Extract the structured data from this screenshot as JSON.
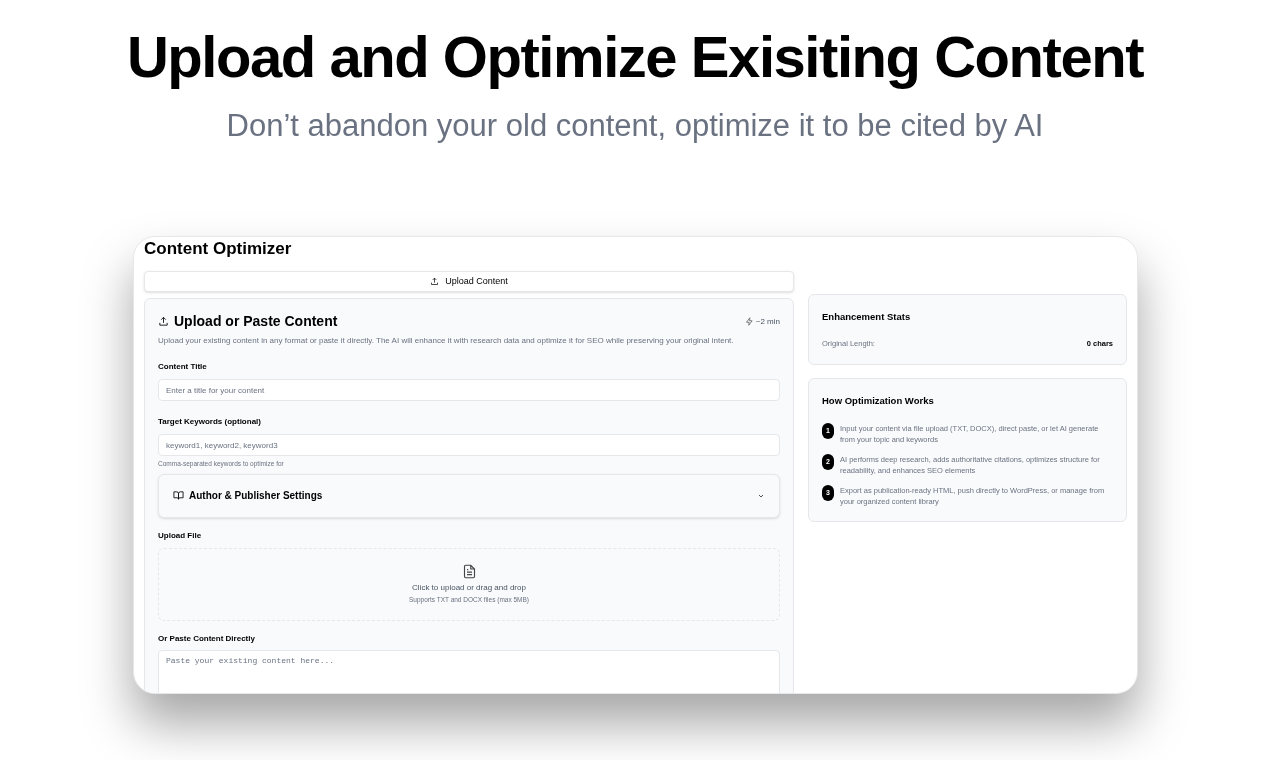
{
  "headline": "Upload and Optimize Exisiting Content",
  "subheadline": "Don’t abandon your old content, optimize it to be cited by AI",
  "app": {
    "title": "Content Optimizer",
    "upload_button": "Upload Content",
    "form": {
      "title": "Upload or Paste Content",
      "estimate": "~2 min",
      "description": "Upload your existing content in any format or paste it directly. The AI will enhance it with research data and optimize it for SEO while preserving your original intent.",
      "content_title": {
        "label": "Content Title",
        "placeholder": "Enter a title for your content"
      },
      "keywords": {
        "label": "Target Keywords (optional)",
        "placeholder": "keyword1, keyword2, keyword3",
        "hint": "Comma-separated keywords to optimize for"
      },
      "author_settings": {
        "label": "Author & Publisher Settings",
        "expanded": false
      },
      "upload_file": {
        "label": "Upload File",
        "prompt": "Click to upload or drag and drop",
        "note": "Supports TXT and DOCX files (max 5MB)"
      },
      "paste": {
        "label": "Or Paste Content Directly",
        "placeholder": "Paste your existing content here..."
      }
    },
    "stats": {
      "title": "Enhancement Stats",
      "rows": [
        {
          "label": "Original Length:",
          "value": "0 chars"
        }
      ]
    },
    "how_it_works": {
      "title": "How Optimization Works",
      "steps": [
        {
          "number": "1",
          "text": "Input your content via file upload (TXT, DOCX), direct paste, or let AI generate from your topic and keywords"
        },
        {
          "number": "2",
          "text": "AI performs deep research, adds authoritative citations, optimizes structure for readability, and enhances SEO elements"
        },
        {
          "number": "3",
          "text": "Export as publication-ready HTML, push directly to WordPress, or manage from your organized content library"
        }
      ]
    }
  }
}
